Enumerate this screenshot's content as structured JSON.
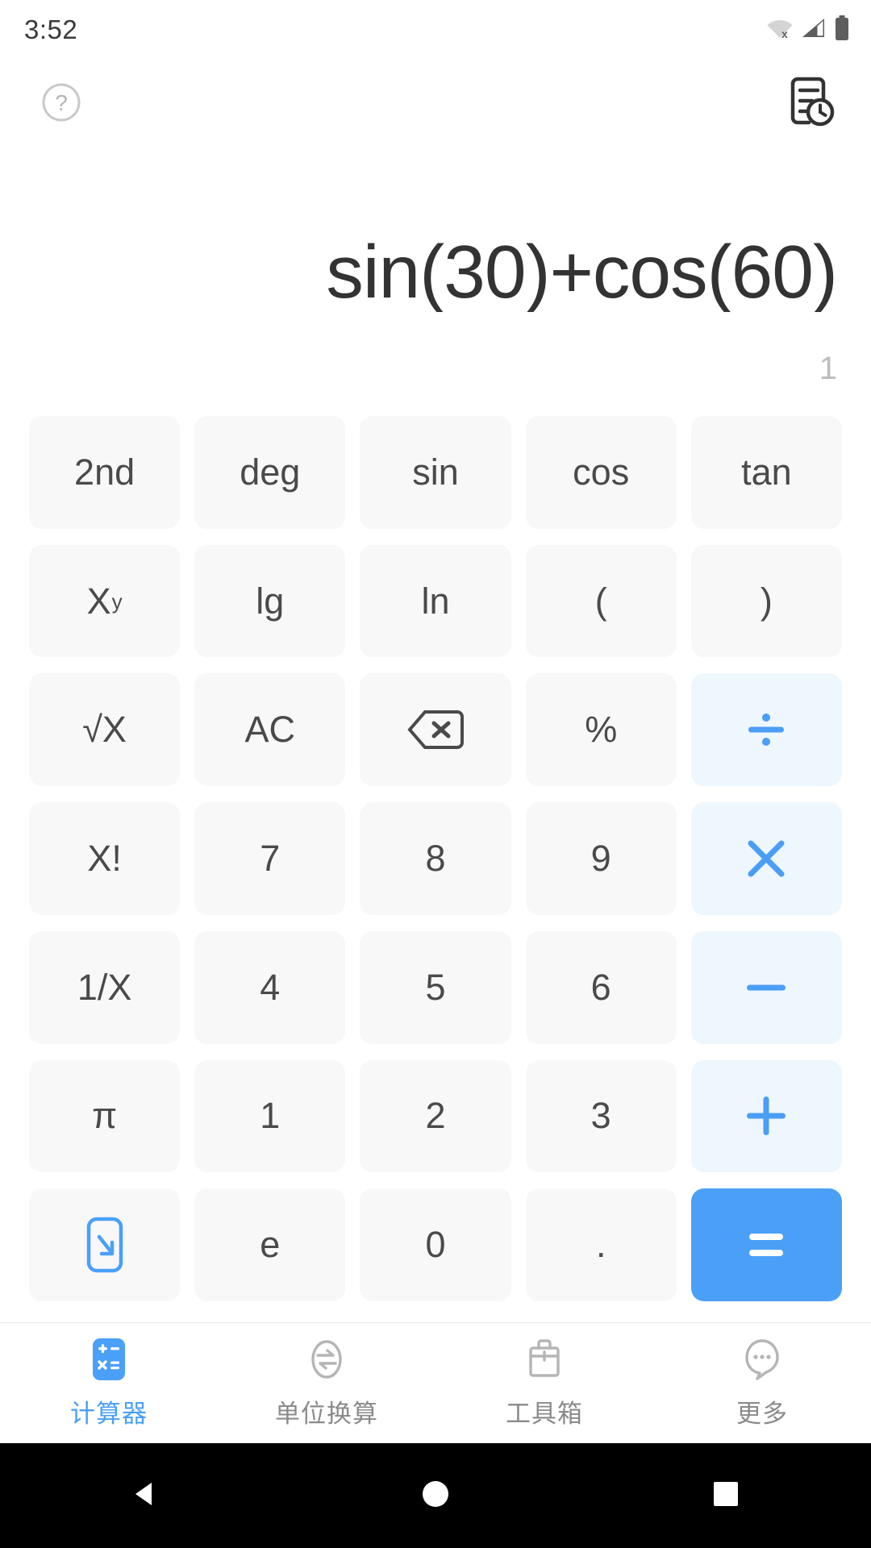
{
  "status": {
    "time": "3:52",
    "icons": [
      "wifi-off-icon",
      "cellular-signal-icon",
      "battery-full-icon"
    ]
  },
  "topbar": {
    "help_icon": "help-circle-icon",
    "history_icon": "history-icon"
  },
  "display": {
    "expression": "sin(30)+cos(60)",
    "result": "1"
  },
  "colors": {
    "accent": "#4aa0f7",
    "operator_bg": "#eef6fe",
    "operator_fg": "#4a9ef5",
    "key_bg": "#f8f8f8",
    "key_fg": "#4a4a4a",
    "result_fg": "#bdbdbd",
    "expression_fg": "#333333"
  },
  "keypad": {
    "rows": [
      [
        {
          "label": "2nd",
          "name": "key-2nd",
          "type": "fn"
        },
        {
          "label": "deg",
          "name": "key-deg",
          "type": "fn"
        },
        {
          "label": "sin",
          "name": "key-sin",
          "type": "fn"
        },
        {
          "label": "cos",
          "name": "key-cos",
          "type": "fn"
        },
        {
          "label": "tan",
          "name": "key-tan",
          "type": "fn"
        }
      ],
      [
        {
          "label": "X",
          "sup": "y",
          "name": "key-power",
          "type": "fn"
        },
        {
          "label": "lg",
          "name": "key-lg",
          "type": "fn"
        },
        {
          "label": "ln",
          "name": "key-ln",
          "type": "fn"
        },
        {
          "label": "(",
          "name": "key-open-paren",
          "type": "fn"
        },
        {
          "label": ")",
          "name": "key-close-paren",
          "type": "fn"
        }
      ],
      [
        {
          "label": "√X",
          "name": "key-sqrt",
          "type": "fn"
        },
        {
          "label": "AC",
          "name": "key-all-clear",
          "type": "fn"
        },
        {
          "label": "",
          "name": "key-backspace",
          "type": "icon",
          "icon": "backspace-icon"
        },
        {
          "label": "%",
          "name": "key-percent",
          "type": "fn"
        },
        {
          "label": "",
          "name": "key-divide",
          "type": "op",
          "icon": "divide-icon"
        }
      ],
      [
        {
          "label": "X!",
          "name": "key-factorial",
          "type": "fn"
        },
        {
          "label": "7",
          "name": "key-7",
          "type": "num"
        },
        {
          "label": "8",
          "name": "key-8",
          "type": "num"
        },
        {
          "label": "9",
          "name": "key-9",
          "type": "num"
        },
        {
          "label": "",
          "name": "key-multiply",
          "type": "op",
          "icon": "multiply-icon"
        }
      ],
      [
        {
          "label": "1/X",
          "name": "key-reciprocal",
          "type": "fn"
        },
        {
          "label": "4",
          "name": "key-4",
          "type": "num"
        },
        {
          "label": "5",
          "name": "key-5",
          "type": "num"
        },
        {
          "label": "6",
          "name": "key-6",
          "type": "num"
        },
        {
          "label": "",
          "name": "key-minus",
          "type": "op",
          "icon": "minus-icon"
        }
      ],
      [
        {
          "label": "π",
          "name": "key-pi",
          "type": "fn"
        },
        {
          "label": "1",
          "name": "key-1",
          "type": "num"
        },
        {
          "label": "2",
          "name": "key-2",
          "type": "num"
        },
        {
          "label": "3",
          "name": "key-3",
          "type": "num"
        },
        {
          "label": "",
          "name": "key-plus",
          "type": "op",
          "icon": "plus-icon"
        }
      ],
      [
        {
          "label": "",
          "name": "key-hide-keypad",
          "type": "icon",
          "icon": "collapse-keypad-icon"
        },
        {
          "label": "e",
          "name": "key-e",
          "type": "fn"
        },
        {
          "label": "0",
          "name": "key-0",
          "type": "num"
        },
        {
          "label": ".",
          "name": "key-decimal",
          "type": "num"
        },
        {
          "label": "",
          "name": "key-equals",
          "type": "eq",
          "icon": "equals-icon"
        }
      ]
    ]
  },
  "bottomnav": {
    "items": [
      {
        "label": "计算器",
        "name": "nav-calculator",
        "icon": "calculator-icon",
        "active": true
      },
      {
        "label": "单位换算",
        "name": "nav-unit-converter",
        "icon": "convert-icon",
        "active": false
      },
      {
        "label": "工具箱",
        "name": "nav-toolbox",
        "icon": "toolbox-icon",
        "active": false
      },
      {
        "label": "更多",
        "name": "nav-more",
        "icon": "more-icon",
        "active": false
      }
    ]
  },
  "sysnav": {
    "back": "back-triangle-icon",
    "home": "home-circle-icon",
    "recents": "recents-square-icon"
  }
}
